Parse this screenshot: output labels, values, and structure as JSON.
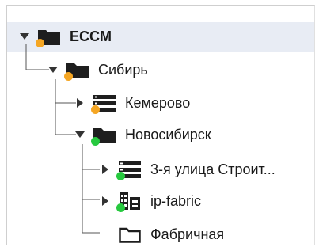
{
  "colors": {
    "status_orange": "#f5a623",
    "status_green": "#27c93f",
    "icon_dark": "#1e1e1e"
  },
  "tree": [
    {
      "label": "ECCM",
      "icon": "folder-icon",
      "status": "orange",
      "expanded": true
    },
    {
      "label": "Сибирь",
      "icon": "folder-icon",
      "status": "orange",
      "expanded": true
    },
    {
      "label": "Кемерово",
      "icon": "server-icon",
      "status": "orange",
      "expanded": false
    },
    {
      "label": "Новосибирск",
      "icon": "folder-icon",
      "status": "green",
      "expanded": true
    },
    {
      "label": "3-я улица Строит...",
      "icon": "server-icon",
      "status": "green",
      "expanded": false
    },
    {
      "label": "ip-fabric",
      "icon": "fabric-icon",
      "status": "green",
      "expanded": false
    },
    {
      "label": "Фабричная",
      "icon": "folder-outline-icon",
      "status": "",
      "expanded": false
    }
  ]
}
